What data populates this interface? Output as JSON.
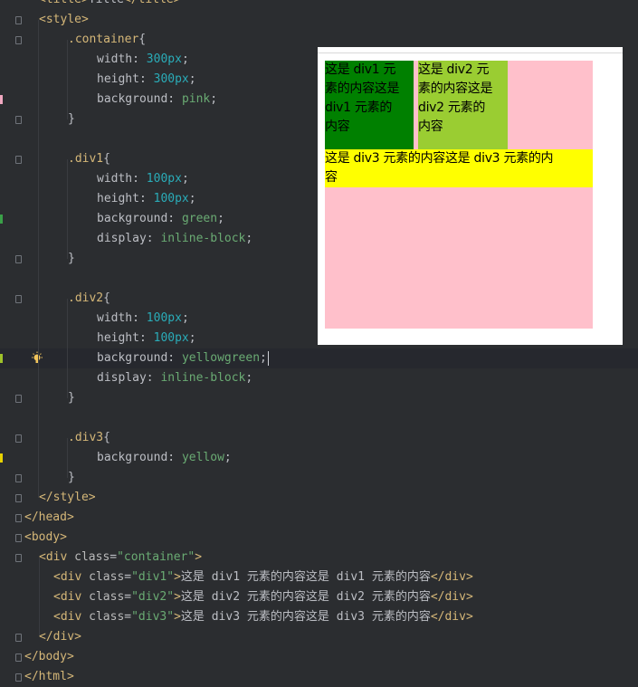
{
  "editor": {
    "lines": [
      [
        [
          "tag",
          "<title>"
        ],
        [
          "ctext",
          "Title"
        ],
        [
          "tag",
          "</title>"
        ]
      ],
      [
        [
          "tag",
          "<style>"
        ]
      ],
      [
        [
          "sel",
          ".container"
        ],
        [
          "bracket",
          "{"
        ]
      ],
      [
        [
          "prop",
          "width"
        ],
        [
          "punc",
          ": "
        ],
        [
          "num",
          "300px"
        ],
        [
          "punc",
          ";"
        ]
      ],
      [
        [
          "prop",
          "height"
        ],
        [
          "punc",
          ": "
        ],
        [
          "num",
          "300px"
        ],
        [
          "punc",
          ";"
        ]
      ],
      [
        [
          "prop",
          "background"
        ],
        [
          "punc",
          ": "
        ],
        [
          "val",
          "pink"
        ],
        [
          "punc",
          ";"
        ]
      ],
      [
        [
          "bracket",
          "}"
        ]
      ],
      [],
      [
        [
          "sel",
          ".div1"
        ],
        [
          "bracket",
          "{"
        ]
      ],
      [
        [
          "prop",
          "width"
        ],
        [
          "punc",
          ": "
        ],
        [
          "num",
          "100px"
        ],
        [
          "punc",
          ";"
        ]
      ],
      [
        [
          "prop",
          "height"
        ],
        [
          "punc",
          ": "
        ],
        [
          "num",
          "100px"
        ],
        [
          "punc",
          ";"
        ]
      ],
      [
        [
          "prop",
          "background"
        ],
        [
          "punc",
          ": "
        ],
        [
          "val",
          "green"
        ],
        [
          "punc",
          ";"
        ]
      ],
      [
        [
          "prop",
          "display"
        ],
        [
          "punc",
          ": "
        ],
        [
          "val",
          "inline-block"
        ],
        [
          "punc",
          ";"
        ]
      ],
      [
        [
          "bracket",
          "}"
        ]
      ],
      [],
      [
        [
          "sel",
          ".div2"
        ],
        [
          "bracket",
          "{"
        ]
      ],
      [
        [
          "prop",
          "width"
        ],
        [
          "punc",
          ": "
        ],
        [
          "num",
          "100px"
        ],
        [
          "punc",
          ";"
        ]
      ],
      [
        [
          "prop",
          "height"
        ],
        [
          "punc",
          ": "
        ],
        [
          "num",
          "100px"
        ],
        [
          "punc",
          ";"
        ]
      ],
      [
        [
          "prop",
          "background"
        ],
        [
          "punc",
          ": "
        ],
        [
          "val",
          "yellowgreen"
        ],
        [
          "punc",
          ";"
        ]
      ],
      [
        [
          "prop",
          "display"
        ],
        [
          "punc",
          ": "
        ],
        [
          "val",
          "inline-block"
        ],
        [
          "punc",
          ";"
        ]
      ],
      [
        [
          "bracket",
          "}"
        ]
      ],
      [],
      [
        [
          "sel",
          ".div3"
        ],
        [
          "bracket",
          "{"
        ]
      ],
      [
        [
          "prop",
          "background"
        ],
        [
          "punc",
          ": "
        ],
        [
          "val",
          "yellow"
        ],
        [
          "punc",
          ";"
        ]
      ],
      [
        [
          "bracket",
          "}"
        ]
      ],
      [
        [
          "tag",
          "</style>"
        ]
      ],
      [
        [
          "tag",
          "</head>"
        ]
      ],
      [
        [
          "tag",
          "<body>"
        ]
      ],
      [
        [
          "tag",
          "<div "
        ],
        [
          "attr",
          "class"
        ],
        [
          "punc",
          "="
        ],
        [
          "str",
          "\"container\""
        ],
        [
          "tag",
          ">"
        ]
      ],
      [
        [
          "tag",
          "<div "
        ],
        [
          "attr",
          "class"
        ],
        [
          "punc",
          "="
        ],
        [
          "str",
          "\"div1\""
        ],
        [
          "tag",
          ">"
        ],
        [
          "ctext",
          "这是 div1 元素的内容这是 div1 元素的内容"
        ],
        [
          "tag",
          "</div>"
        ]
      ],
      [
        [
          "tag",
          "<div "
        ],
        [
          "attr",
          "class"
        ],
        [
          "punc",
          "="
        ],
        [
          "str",
          "\"div2\""
        ],
        [
          "tag",
          ">"
        ],
        [
          "ctext",
          "这是 div2 元素的内容这是 div2 元素的内容"
        ],
        [
          "tag",
          "</div>"
        ]
      ],
      [
        [
          "tag",
          "<div "
        ],
        [
          "attr",
          "class"
        ],
        [
          "punc",
          "="
        ],
        [
          "str",
          "\"div3\""
        ],
        [
          "tag",
          ">"
        ],
        [
          "ctext",
          "这是 div3 元素的内容这是 div3 元素的内容"
        ],
        [
          "tag",
          "</div>"
        ]
      ],
      [
        [
          "tag",
          "</div>"
        ]
      ],
      [
        [
          "tag",
          "</body>"
        ]
      ],
      [
        [
          "tag",
          "</html>"
        ]
      ]
    ]
  },
  "preview": {
    "div1_text": [
      "这是 div1 元",
      "素的内容这是",
      "div1 元素的",
      "内容"
    ],
    "div2_text": [
      "这是 div2 元",
      "素的内容这是",
      "div2 元素的",
      "内容"
    ],
    "div3_text": [
      "这是 div3 元素的内容这是 div3 元素的内",
      "容"
    ]
  },
  "colors": {
    "editor_bg": "#2b2d30",
    "container_bg": "pink",
    "div1_bg": "green",
    "div2_bg": "yellowgreen",
    "div3_bg": "yellow"
  }
}
